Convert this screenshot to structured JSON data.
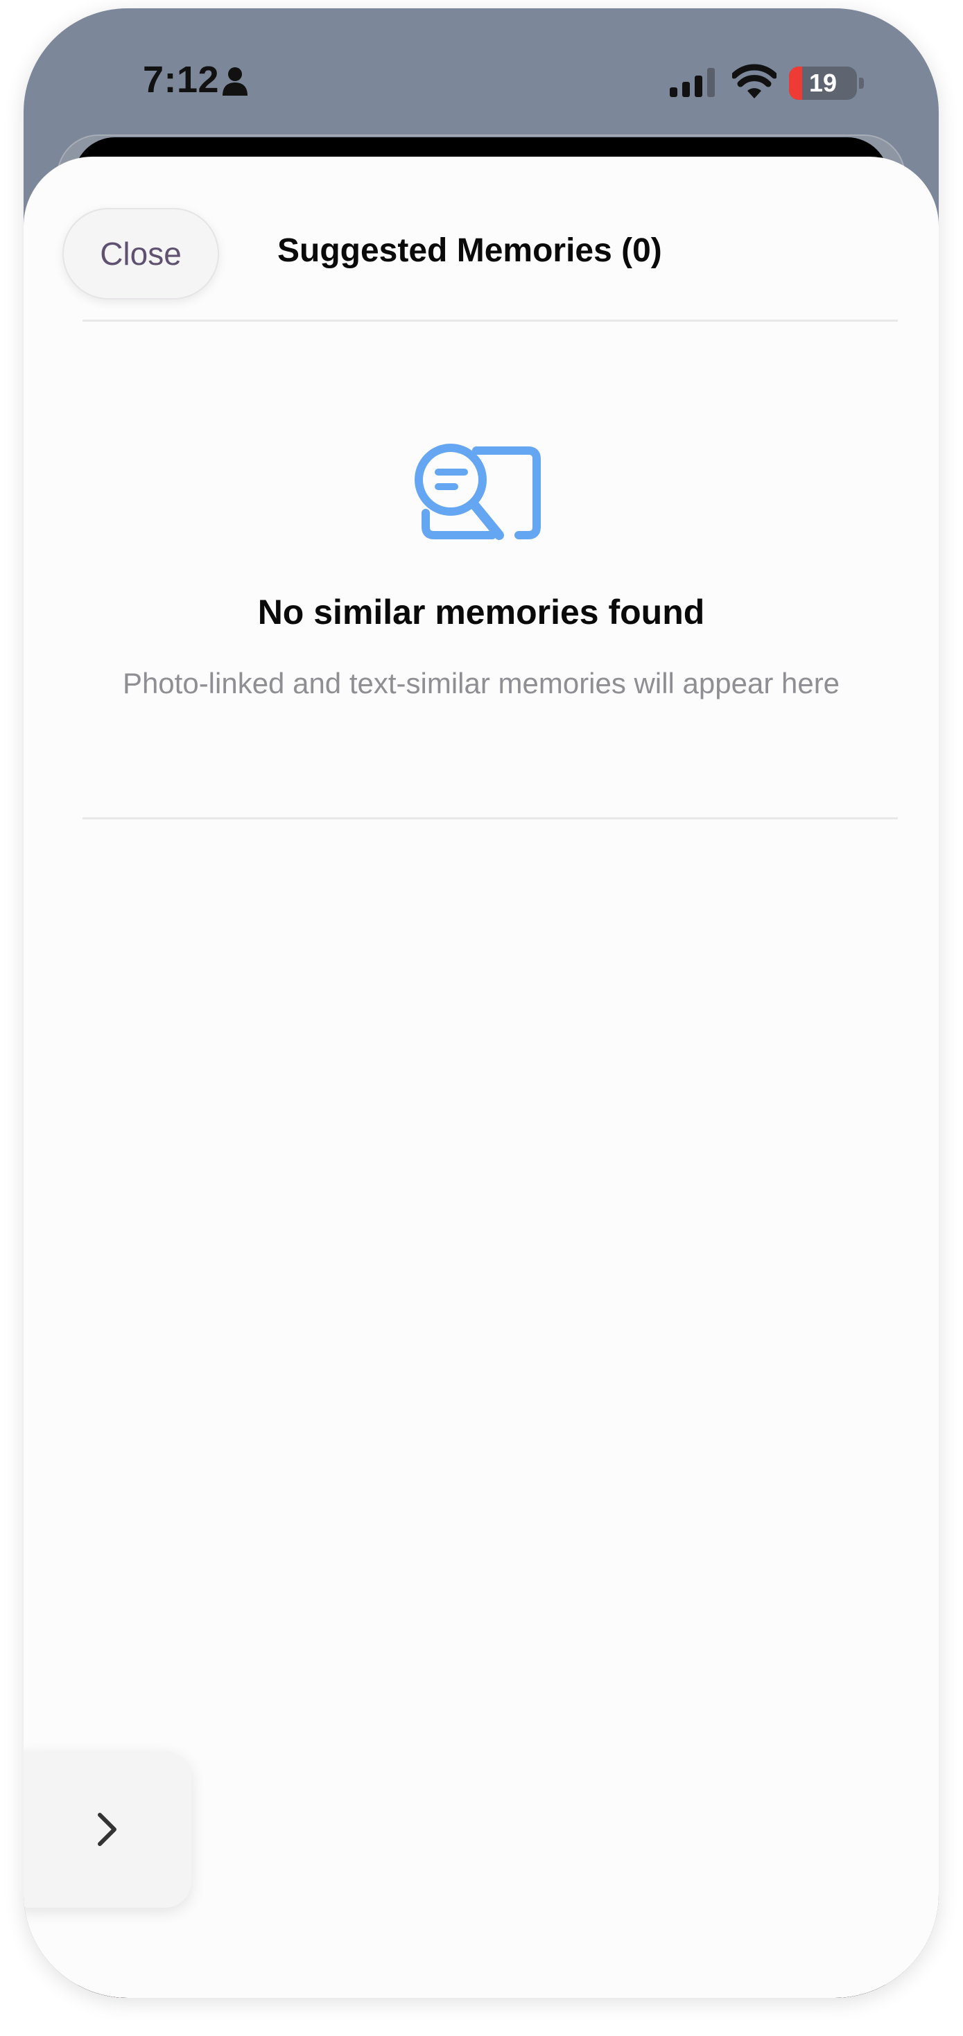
{
  "status_bar": {
    "time": "7:12",
    "battery_level": "19",
    "battery_fraction": 0.19,
    "icons": [
      "person-icon",
      "cellular-signal-icon",
      "wifi-icon",
      "battery-icon"
    ]
  },
  "sheet": {
    "close_label": "Close",
    "title": "Suggested Memories (0)"
  },
  "empty_state": {
    "icon": "search-message-icon",
    "title": "No similar memories found",
    "subtitle": "Photo-linked and text-similar memories will appear here"
  },
  "side_tab": {
    "icon": "chevron-right-icon"
  },
  "colors": {
    "accent": "#64a6f2",
    "battery_low": "#ee3b34",
    "close_text": "#5f5270",
    "subtitle_text": "#8e8e93"
  }
}
